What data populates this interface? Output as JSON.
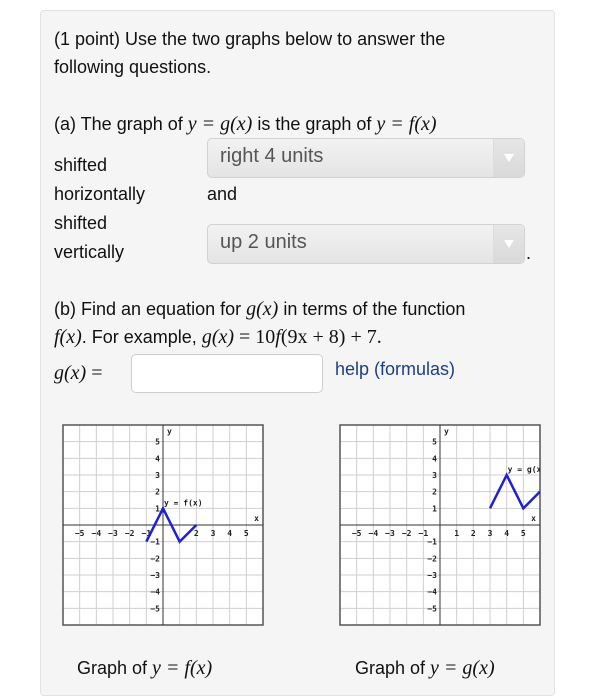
{
  "problem": {
    "intro_line1": "(1 point) Use the two graphs below to answer the",
    "intro_line2": "following questions."
  },
  "part_a": {
    "prefix": "(a) The graph of ",
    "g_expr": "y = g(x)",
    "middle": " is the graph of ",
    "f_expr": "y = f(x)",
    "label_shifted_1": "shifted",
    "label_horizontally": "horizontally",
    "label_shifted_2": "shifted",
    "label_vertically": "vertically",
    "and_text": "and",
    "period": ".",
    "horizontal_select": {
      "selected": "right 4 units",
      "icon": "chevron-down-icon"
    },
    "vertical_select": {
      "selected": "up 2 units",
      "icon": "chevron-down-icon"
    }
  },
  "part_b": {
    "line1_prefix": "(b) Find an equation for ",
    "line1_g": "g(x)",
    "line1_suffix": " in terms of the function",
    "line2_f": "f(x)",
    "line2_mid": ". For example, ",
    "line2_example_g": "g(x)",
    "line2_example_eq": " = 10",
    "line2_example_f": "f",
    "line2_example_rest": "(9x + 8) + 7.",
    "answer_label_g": "g(x)",
    "answer_label_eq": " =",
    "answer_value": "",
    "answer_placeholder": "",
    "help_link": "help (formulas)"
  },
  "colors": {
    "curve": "#1f1fd6",
    "link": "#1c3e86",
    "panel_bg": "#f5f5f5"
  },
  "captions": {
    "left_prefix": "Graph of ",
    "left_math": "y = f(x)",
    "right_prefix": "Graph of ",
    "right_math": "y = g(x)"
  },
  "chart_data": [
    {
      "type": "line",
      "title": "Graph of y = f(x)",
      "xlabel": "x",
      "ylabel": "y",
      "xlim": [
        -6,
        6
      ],
      "ylim": [
        -6,
        6
      ],
      "grid": true,
      "x_ticks": [
        -5,
        -4,
        -3,
        -2,
        -1,
        2,
        3,
        4,
        5
      ],
      "y_ticks": [
        5,
        4,
        3,
        2,
        1,
        -1,
        -2,
        -3,
        -4,
        -5
      ],
      "series": [
        {
          "name": "y = f(x)",
          "x": [
            -1,
            0,
            1,
            2
          ],
          "y": [
            -1,
            1,
            -1,
            0
          ]
        }
      ],
      "annotation": "y = f(x)"
    },
    {
      "type": "line",
      "title": "Graph of y = g(x)",
      "xlabel": "x",
      "ylabel": "y",
      "xlim": [
        -6,
        6
      ],
      "ylim": [
        -6,
        6
      ],
      "grid": true,
      "x_ticks": [
        -5,
        -4,
        -3,
        -2,
        -1,
        1,
        2,
        3,
        4,
        5
      ],
      "y_ticks": [
        5,
        4,
        3,
        2,
        1,
        -1,
        -2,
        -3,
        -4,
        -5
      ],
      "series": [
        {
          "name": "y = g(x)",
          "x": [
            3,
            4,
            5,
            6
          ],
          "y": [
            1,
            3,
            1,
            2
          ]
        }
      ],
      "annotation": "y = g(x"
    }
  ]
}
